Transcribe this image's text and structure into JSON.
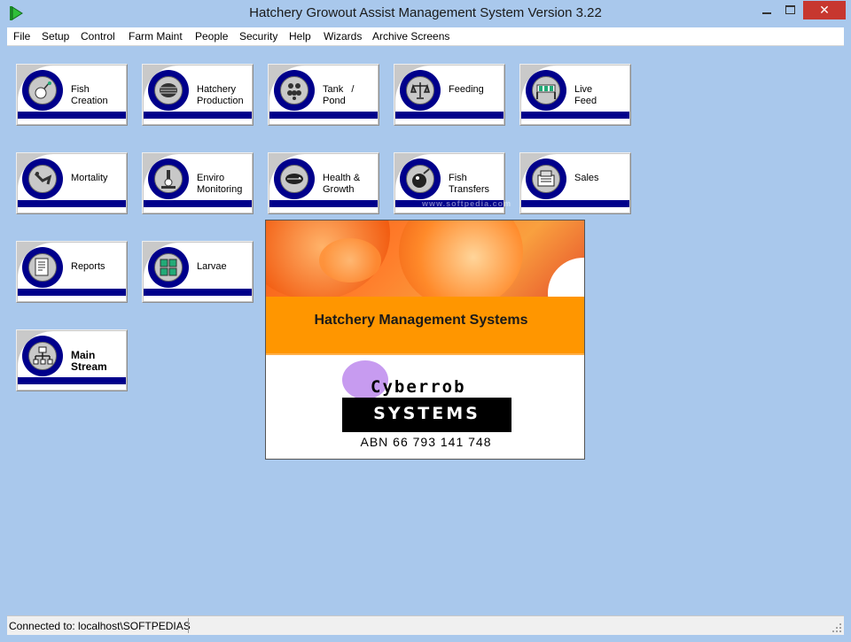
{
  "window": {
    "title": "Hatchery Growout Assist Management System Version 3.22",
    "min_glyph": "",
    "max_glyph": "",
    "close_glyph": "✕"
  },
  "menu": [
    "File",
    "Setup",
    "Control",
    "Farm Maint",
    "People",
    "Security",
    "Help",
    "Wizards",
    "Archive Screens"
  ],
  "buttons": [
    {
      "label": "Fish\nCreation",
      "icon": "fish-creation-icon"
    },
    {
      "label": "Hatchery\nProduction",
      "icon": "hatchery-production-icon"
    },
    {
      "label": "Tank   /\nPond",
      "icon": "tank-pond-icon"
    },
    {
      "label": "Feeding",
      "icon": "scales-icon"
    },
    {
      "label": "Live\nFeed",
      "icon": "live-feed-icon"
    },
    {
      "label": "Mortality",
      "icon": "mortality-icon"
    },
    {
      "label": "Enviro\nMonitoring",
      "icon": "microscope-icon"
    },
    {
      "label": "Health &\nGrowth",
      "icon": "fish-health-icon"
    },
    {
      "label": "Fish\nTransfers",
      "icon": "fish-transfer-icon"
    },
    {
      "label": "Sales",
      "icon": "cash-register-icon"
    },
    {
      "label": "Reports",
      "icon": "report-icon"
    },
    {
      "label": "Larvae",
      "icon": "larvae-icon"
    },
    {
      "label": "Main\nStream",
      "icon": "org-chart-icon"
    }
  ],
  "splash": {
    "title": "Hatchery Management Systems",
    "company": "Cyberrob",
    "systems": "SYSTEMS",
    "abn": "ABN 66 793 141 748",
    "colors": {
      "orange": "#ff9600",
      "lilac": "#c79bf0"
    }
  },
  "watermark": "www.softpedia.com",
  "status": {
    "connection": "Connected to: localhost\\SOFTPEDIAS"
  },
  "colors": {
    "background": "#a9c8ec",
    "button_bar": "#00008b",
    "close": "#c7372f"
  }
}
